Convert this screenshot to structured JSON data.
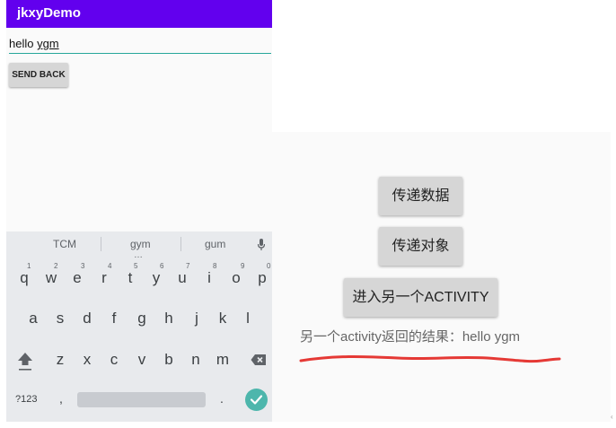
{
  "app_bar": {
    "title": "jkxyDemo",
    "color": "#6200ee"
  },
  "edit_field": {
    "text_prefix": "hello ",
    "text_underlined": "ygm"
  },
  "send_back_button": {
    "label": "SEND BACK"
  },
  "keyboard": {
    "suggestions": [
      "TCM",
      "gym",
      "gum"
    ],
    "row1": [
      {
        "key": "q",
        "num": "1"
      },
      {
        "key": "w",
        "num": "2"
      },
      {
        "key": "e",
        "num": "3"
      },
      {
        "key": "r",
        "num": "4"
      },
      {
        "key": "t",
        "num": "5"
      },
      {
        "key": "y",
        "num": "6"
      },
      {
        "key": "u",
        "num": "7"
      },
      {
        "key": "i",
        "num": "8"
      },
      {
        "key": "o",
        "num": "9"
      },
      {
        "key": "p",
        "num": "0"
      }
    ],
    "row2": [
      "a",
      "s",
      "d",
      "f",
      "g",
      "h",
      "j",
      "k",
      "l"
    ],
    "row3": [
      "z",
      "x",
      "c",
      "v",
      "b",
      "n",
      "m"
    ],
    "symbols_key": "?123",
    "comma_key": ",",
    "period_key": ".",
    "accent_color": "#4db6ac"
  },
  "right_screen": {
    "button_pass_data": "传递数据",
    "button_pass_object": "传递对象",
    "button_enter_activity": "进入另一个ACTIVITY",
    "result_text": "另一个activity返回的结果：hello ygm",
    "annotation_color": "#e53935"
  },
  "edge_mark": "‹"
}
